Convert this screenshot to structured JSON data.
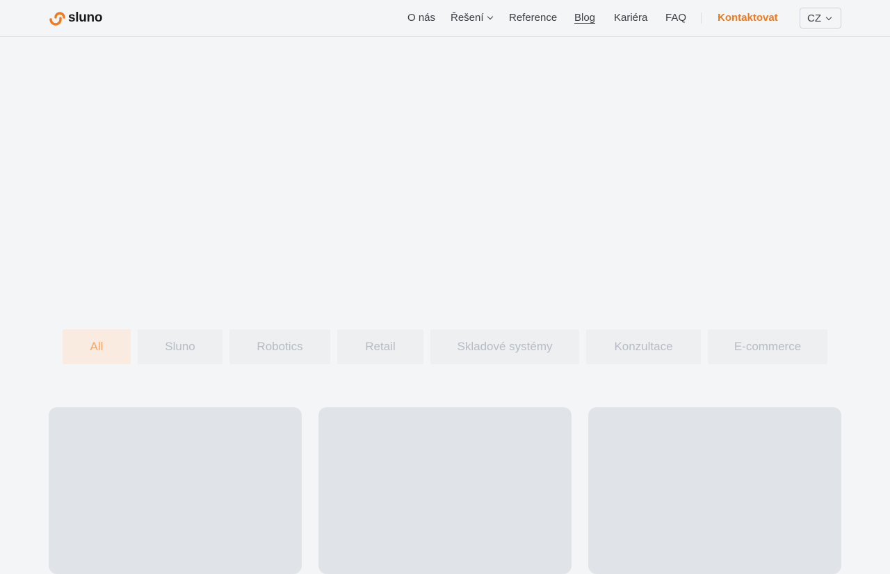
{
  "header": {
    "logo_text": "sluno",
    "nav": [
      {
        "label": "O nás"
      },
      {
        "label": "Řešení",
        "has_dropdown": true
      },
      {
        "label": "Reference"
      },
      {
        "label": "Blog",
        "active": true
      },
      {
        "label": "Kariéra"
      },
      {
        "label": "FAQ"
      }
    ],
    "contact_label": "Kontaktovat",
    "language": "CZ"
  },
  "filters": [
    {
      "label": "All",
      "active": true
    },
    {
      "label": "Sluno"
    },
    {
      "label": "Robotics"
    },
    {
      "label": "Retail"
    },
    {
      "label": "Skladové systémy"
    },
    {
      "label": "Konzultace"
    },
    {
      "label": "E-commerce"
    }
  ],
  "colors": {
    "accent": "#f07a1c",
    "background": "#f4f5f7",
    "card_placeholder": "#e0e3e8"
  }
}
